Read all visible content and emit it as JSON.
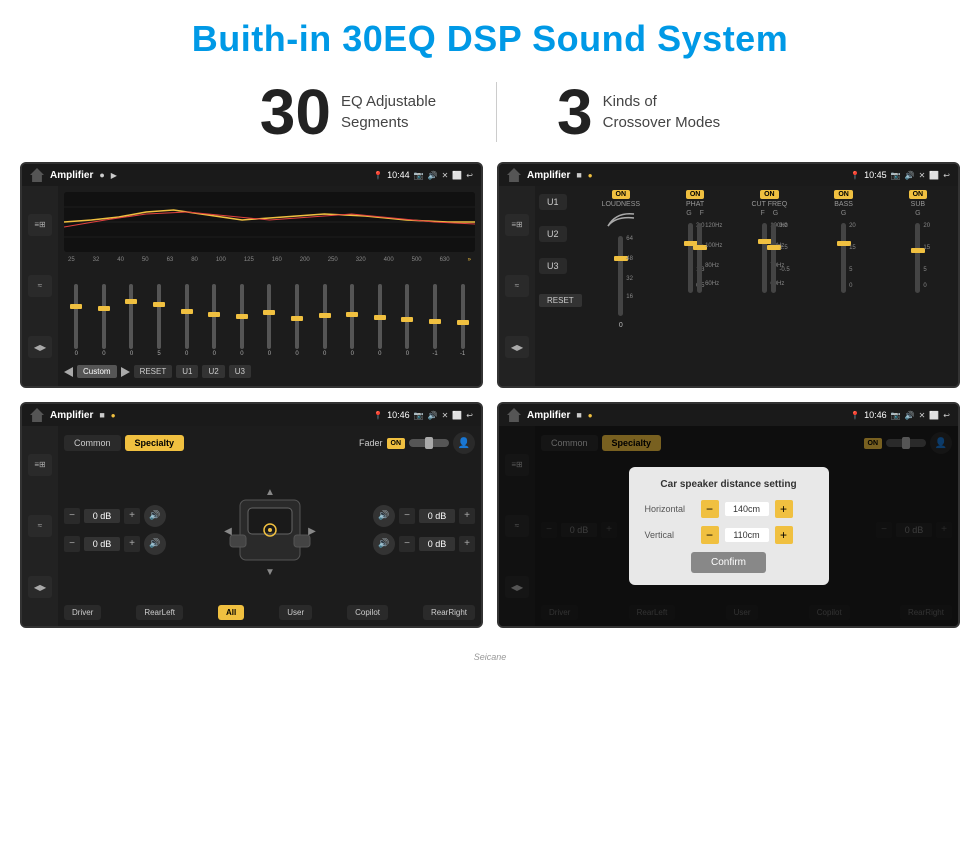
{
  "page": {
    "title": "Buith-in 30EQ DSP Sound System",
    "stats": [
      {
        "number": "30",
        "text_line1": "EQ Adjustable",
        "text_line2": "Segments"
      },
      {
        "number": "3",
        "text_line1": "Kinds of",
        "text_line2": "Crossover Modes"
      }
    ]
  },
  "screens": {
    "screen1": {
      "app_title": "Amplifier",
      "time": "10:44",
      "freq_labels": [
        "25",
        "32",
        "40",
        "50",
        "63",
        "80",
        "100",
        "125",
        "160",
        "200",
        "250",
        "320",
        "400",
        "500",
        "630"
      ],
      "bottom_buttons": [
        "Custom",
        "RESET",
        "U1",
        "U2",
        "U3"
      ]
    },
    "screen2": {
      "app_title": "Amplifier",
      "time": "10:45",
      "sections": [
        "U1",
        "U2",
        "U3"
      ],
      "labels": [
        "LOUDNESS",
        "PHAT",
        "CUT FREQ",
        "BASS",
        "SUB"
      ],
      "on_badges": [
        "ON",
        "ON",
        "ON",
        "ON",
        "ON"
      ],
      "reset_label": "RESET"
    },
    "screen3": {
      "app_title": "Amplifier",
      "time": "10:46",
      "tabs": [
        "Common",
        "Specialty"
      ],
      "active_tab": "Specialty",
      "fader_label": "Fader",
      "on_label": "ON",
      "db_values": [
        "0 dB",
        "0 dB",
        "0 dB",
        "0 dB"
      ],
      "bottom_buttons": [
        "Driver",
        "RearLeft",
        "All",
        "User",
        "Copilot",
        "RearRight"
      ]
    },
    "screen4": {
      "app_title": "Amplifier",
      "time": "10:46",
      "tabs": [
        "Common",
        "Specialty"
      ],
      "active_tab": "Specialty",
      "on_label": "ON",
      "dialog": {
        "title": "Car speaker distance setting",
        "horizontal_label": "Horizontal",
        "horizontal_value": "140cm",
        "vertical_label": "Vertical",
        "vertical_value": "110cm",
        "confirm_label": "Confirm"
      },
      "db_values": [
        "0 dB",
        "0 dB"
      ],
      "bottom_buttons": [
        "Driver",
        "RearLeft",
        "User",
        "Copilot",
        "RearRight"
      ]
    }
  },
  "watermark": "Seicane"
}
